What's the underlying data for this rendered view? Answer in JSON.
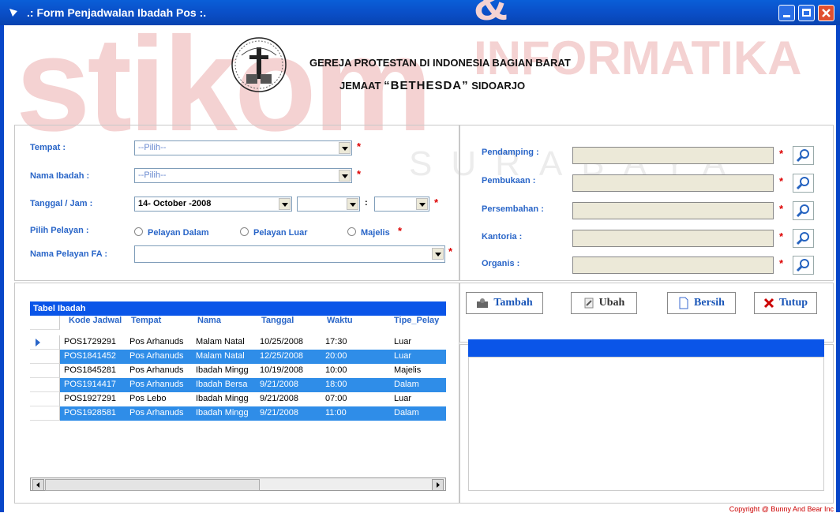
{
  "window": {
    "title": ".: Form Penjadwalan Ibadah Pos :."
  },
  "watermark": {
    "main": "stikom",
    "sub": "SURABAYA",
    "top": "& INFORMATIKA"
  },
  "header": {
    "line1": "GEREJA PROTESTAN DI INDONESIA BAGIAN BARAT",
    "line2_pre": "JEMAAT",
    "line2_name": "“BETHESDA”",
    "line2_post": "SIDOARJO"
  },
  "form": {
    "tempat": {
      "label": "Tempat :",
      "value": "--Pilih--"
    },
    "nama_ibadah": {
      "label": "Nama Ibadah :",
      "value": "--Pilih--"
    },
    "tanggal": {
      "label": "Tanggal / Jam :",
      "value": "14- October -2008"
    },
    "pilih_pelayan": {
      "label": "Pilih Pelayan :",
      "options": [
        "Pelayan Dalam",
        "Pelayan Luar",
        "Majelis"
      ]
    },
    "nama_pelayan": {
      "label": "Nama Pelayan FA :"
    },
    "time_sep": ":",
    "required": "*"
  },
  "right_form": {
    "pendamping": "Pendamping :",
    "pembukaan": "Pembukaan :",
    "persembahan": "Persembahan :",
    "kantoria": "Kantoria :",
    "organis": "Organis :"
  },
  "buttons": {
    "tambah": "Tambah",
    "ubah": "Ubah",
    "bersih": "Bersih",
    "tutup": "Tutup"
  },
  "table": {
    "caption": "Tabel Ibadah",
    "columns": [
      "Kode Jadwal",
      "Tempat",
      "Nama",
      "Tanggal",
      "Waktu",
      "Tipe_Pelay"
    ],
    "rows": [
      [
        "POS1729291",
        "Pos Arhanuds",
        "Malam Natal",
        "10/25/2008",
        "17:30",
        "Luar"
      ],
      [
        "POS1841452",
        "Pos Arhanuds",
        "Malam Natal",
        "12/25/2008",
        "20:00",
        "Luar"
      ],
      [
        "POS1845281",
        "Pos Arhanuds",
        "Ibadah Mingg",
        "10/19/2008",
        "10:00",
        "Majelis"
      ],
      [
        "POS1914417",
        "Pos Arhanuds",
        "Ibadah Bersa",
        "9/21/2008",
        "18:00",
        "Dalam"
      ],
      [
        "POS1927291",
        "Pos Lebo",
        "Ibadah Mingg",
        "9/21/2008",
        "07:00",
        "Luar"
      ],
      [
        "POS1928581",
        "Pos Arhanuds",
        "Ibadah Mingg",
        "9/21/2008",
        "11:00",
        "Dalam"
      ]
    ]
  },
  "copyright": "Copyright @ Bunny And Bear Inc"
}
